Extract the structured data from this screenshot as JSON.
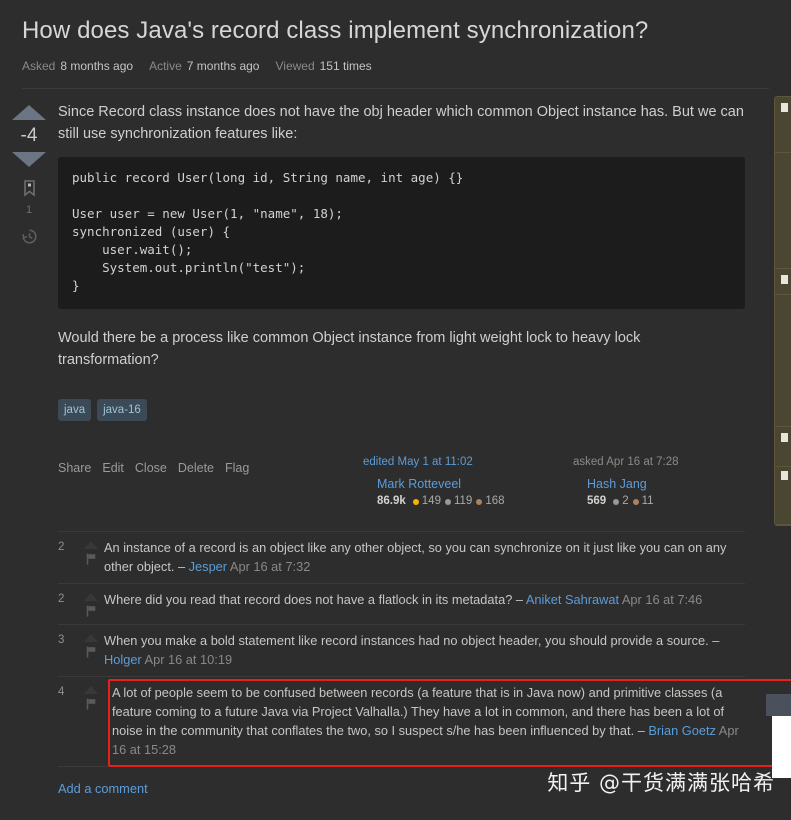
{
  "question": {
    "title": "How does Java's record class implement synchronization?",
    "meta": [
      {
        "label": "Asked",
        "value": "8 months ago"
      },
      {
        "label": "Active",
        "value": "7 months ago"
      },
      {
        "label": "Viewed",
        "value": "151 times"
      }
    ]
  },
  "vote": {
    "score": "-4",
    "bookmark_count": "1",
    "up_icon": "arrow-up-icon",
    "down_icon": "arrow-down-icon",
    "bookmark_icon": "bookmark-icon",
    "history_icon": "history-icon"
  },
  "body": {
    "paragraph1": "Since Record class instance does not have the obj header which common Object instance has. But we can still use synchronization features like:",
    "code": "public record User(long id, String name, int age) {}\n\nUser user = new User(1, \"name\", 18);\nsynchronized (user) {\n    user.wait();\n    System.out.println(\"test\");\n}",
    "paragraph2": "Would there be a process like common Object instance from light weight lock to heavy lock transformation?"
  },
  "tags": [
    "java",
    "java-16"
  ],
  "actions": [
    "Share",
    "Edit",
    "Close",
    "Delete",
    "Flag"
  ],
  "user_cards": [
    {
      "when": "edited May 1 at 11:02",
      "when_is_link": true,
      "name": "Mark Rotteveel",
      "reputation": "86.9k",
      "gold": "149",
      "silver": "119",
      "bronze": "168"
    },
    {
      "when": "asked Apr 16 at 7:28",
      "when_is_link": false,
      "name": "Hash Jang",
      "reputation": "569",
      "gold": "",
      "silver": "2",
      "bronze": "11"
    }
  ],
  "comments": [
    {
      "score": "2",
      "text": "An instance of a record is an object like any other object, so you can synchronize on it just like you can on any other object. – ",
      "author": "Jesper",
      "date": " Apr 16 at 7:32",
      "highlighted": false
    },
    {
      "score": "2",
      "text": "Where did you read that record does not have a flatlock in its metadata? – ",
      "author": "Aniket Sahrawat",
      "date": " Apr 16 at 7:46",
      "highlighted": false
    },
    {
      "score": "3",
      "text": "When you make a bold statement like record instances had no object header, you should provide a source. – ",
      "author": "Holger",
      "date": " Apr 16 at 10:19",
      "highlighted": false
    },
    {
      "score": "4",
      "text": "A lot of people seem to be confused between records (a feature that is in Java now) and primitive classes (a feature coming to a future Java via Project Valhalla.) They have a lot in common, and there has been a lot of noise in the community that conflates the two, so I suspect s/he has been influenced by that. – ",
      "author": "Brian Goetz",
      "date": " Apr 16 at 15:28",
      "highlighted": true
    }
  ],
  "add_comment_label": "Add a comment",
  "watermark": "知乎 @干货满满张哈希",
  "colors": {
    "background": "#2d2d2d",
    "code_background": "#1c1c1c",
    "link": "#5b9dd9",
    "tag_bg": "#3b4a56",
    "tag_text": "#9cc3d8",
    "highlight_border": "#e8201a",
    "gold_badge": "#f1b600",
    "silver_badge": "#9a9996",
    "bronze_badge": "#ab825f",
    "sidebar_panel": "#4a4632"
  }
}
